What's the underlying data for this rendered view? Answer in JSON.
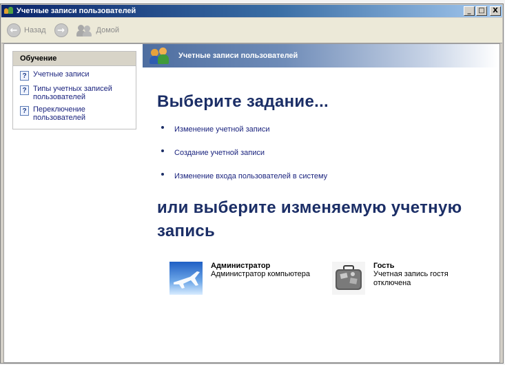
{
  "window": {
    "title": "Учетные записи пользователей",
    "buttons": {
      "minimize": "_",
      "maximize": "□",
      "close": "X"
    }
  },
  "toolbar": {
    "back_label": "Назад",
    "forward_glyph": "→",
    "back_glyph": "←",
    "home_label": "Домой"
  },
  "sidebar": {
    "heading": "Обучение",
    "items": [
      {
        "label": "Учетные записи",
        "icon": "help-question-icon"
      },
      {
        "label": "Типы учетных записей пользователей",
        "icon": "help-question-icon"
      },
      {
        "label": "Переключение пользователей",
        "icon": "help-question-icon"
      }
    ]
  },
  "banner": {
    "title": "Учетные записи пользователей"
  },
  "main": {
    "task_heading": "Выберите задание...",
    "tasks": [
      "Изменение учетной записи",
      "Создание учетной записи",
      "Изменение входа пользователей в систему"
    ],
    "account_heading_line1": "или выберите изменяемую учетную",
    "account_heading_line2": "запись",
    "accounts": [
      {
        "name": "Администратор",
        "description": "Администратор компьютера",
        "picture": "airplane-picture"
      },
      {
        "name": "Гость",
        "description_line1": "Учетная запись гостя",
        "description_line2": "отключена",
        "picture": "suitcase-picture"
      }
    ]
  },
  "colors": {
    "heading": "#1b2e66",
    "link": "#1a237e",
    "titlebar": "#0a246a"
  }
}
